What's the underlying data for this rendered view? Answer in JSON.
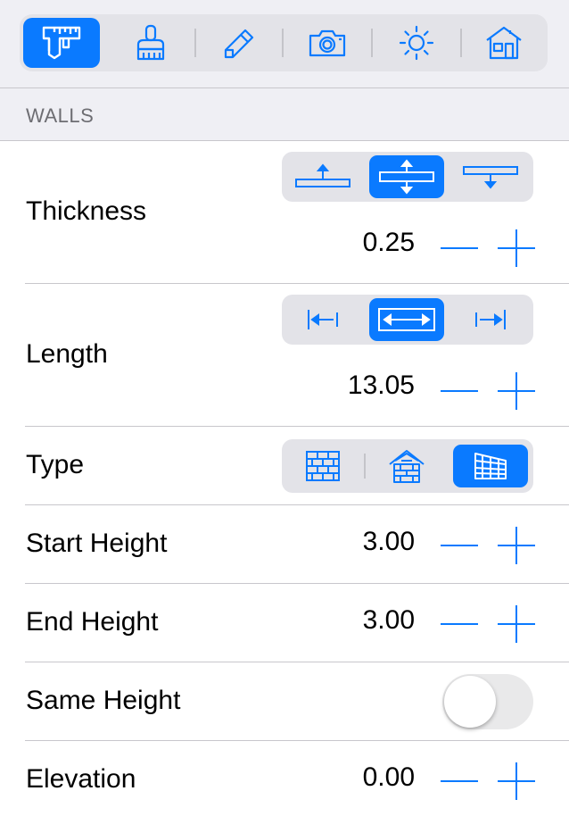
{
  "toolbar": {
    "items": [
      {
        "icon": "caliper-icon",
        "active": true
      },
      {
        "icon": "brush-icon",
        "active": false
      },
      {
        "icon": "pencil-icon",
        "active": false
      },
      {
        "icon": "camera-icon",
        "active": false
      },
      {
        "icon": "sun-icon",
        "active": false
      },
      {
        "icon": "house-icon",
        "active": false
      }
    ],
    "accent": "#0a7aff"
  },
  "section": {
    "title": "WALLS"
  },
  "thickness": {
    "label": "Thickness",
    "value": "0.25",
    "align_options": [
      "align-top-icon",
      "align-center-icon",
      "align-bottom-icon"
    ],
    "selected": 1
  },
  "length": {
    "label": "Length",
    "value": "13.05",
    "align_options": [
      "arrow-left-icon",
      "arrow-both-icon",
      "arrow-right-icon"
    ],
    "selected": 1
  },
  "type": {
    "label": "Type",
    "options": [
      "brick-wall-icon",
      "brick-house-icon",
      "grid-wall-icon"
    ],
    "selected": 2
  },
  "start_height": {
    "label": "Start Height",
    "value": "3.00"
  },
  "end_height": {
    "label": "End Height",
    "value": "3.00"
  },
  "same_height": {
    "label": "Same Height",
    "on": false
  },
  "elevation": {
    "label": "Elevation",
    "value": "0.00"
  }
}
